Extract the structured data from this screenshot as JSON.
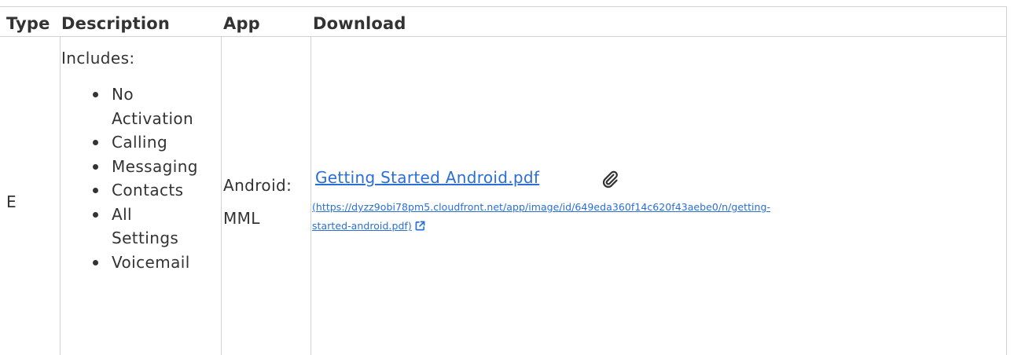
{
  "table": {
    "headers": {
      "type": "Type",
      "description": "Description",
      "app": "App",
      "download": "Download"
    },
    "rows": [
      {
        "type": "E",
        "description": {
          "intro": "Includes:",
          "items": [
            {
              "line1": "No",
              "line2": "Activation"
            },
            {
              "line1": "Calling"
            },
            {
              "line1": "Messaging"
            },
            {
              "line1": "Contacts"
            },
            {
              "line1": "All",
              "line2": "Settings"
            },
            {
              "line1": "Voicemail"
            }
          ]
        },
        "app": {
          "line1": "Android:",
          "line2": "MML"
        },
        "download": {
          "link_text": "Getting Started Android.pdf",
          "url_line1": "(https://dyzz9obi78pm5.cloudfront.net/app/image/id/649eda360f14c620f43aebe0/n/getting-",
          "url_line2": "started-android.pdf)",
          "attachment_icon": "paperclip-icon",
          "external_icon": "external-link-icon"
        }
      }
    ]
  },
  "colors": {
    "text": "#333333",
    "link": "#2a6fd6",
    "border": "#d2d2d2"
  }
}
